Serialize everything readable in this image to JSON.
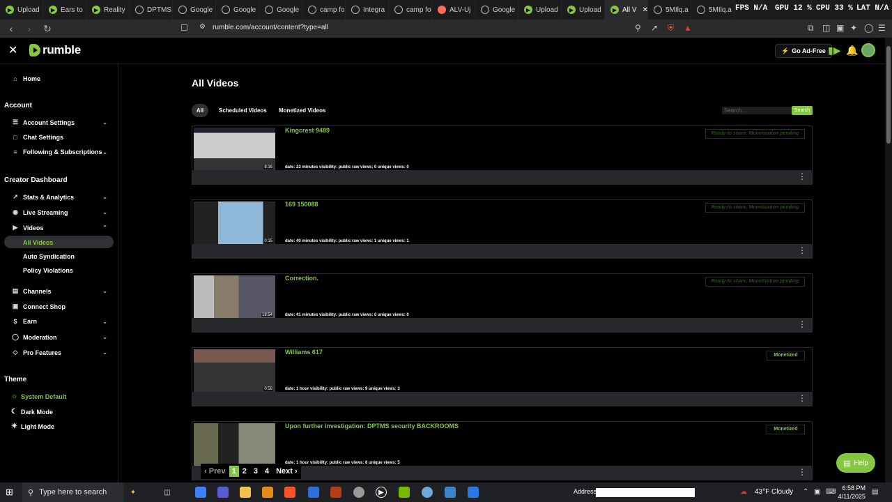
{
  "browser": {
    "tabs": [
      {
        "label": "Upload",
        "icon": "rumble-icon",
        "active": false
      },
      {
        "label": "Ears to",
        "icon": "rumble-icon",
        "active": false
      },
      {
        "label": "Reality",
        "icon": "rumble-icon",
        "active": false
      },
      {
        "label": "DPTMS",
        "icon": "globe-icon",
        "active": false
      },
      {
        "label": "Google",
        "icon": "globe-icon",
        "active": false
      },
      {
        "label": "Google",
        "icon": "globe-icon",
        "active": false
      },
      {
        "label": "Google",
        "icon": "globe-icon",
        "active": false
      },
      {
        "label": "camp fo",
        "icon": "globe-icon",
        "active": false
      },
      {
        "label": "Integra",
        "icon": "globe-icon",
        "active": false
      },
      {
        "label": "camp fo",
        "icon": "globe-icon",
        "active": false
      },
      {
        "label": "ALV-Uj",
        "icon": "brand-icon",
        "active": false
      },
      {
        "label": "Google",
        "icon": "globe-icon",
        "active": false
      },
      {
        "label": "Upload",
        "icon": "rumble-icon",
        "active": false
      },
      {
        "label": "Upload",
        "icon": "rumble-icon",
        "active": false
      },
      {
        "label": "All V",
        "icon": "rumble-icon",
        "active": true
      },
      {
        "label": "5MIlq.a",
        "icon": "globe-icon",
        "active": false
      },
      {
        "label": "5MIlq.a",
        "icon": "globe-icon",
        "active": false
      }
    ],
    "hud": {
      "fps": "FPS N/A",
      "gpu": "GPU 12 %",
      "cpu": "CPU 33 %",
      "lat": "LAT N/A"
    },
    "url": "rumble.com/account/content?type=all"
  },
  "header": {
    "logo": "rumble",
    "go_adfree": "Go Ad-Free"
  },
  "sidebar": {
    "home": "Home",
    "account_heading": "Account",
    "account_items": [
      "Account Settings",
      "Chat Settings",
      "Following & Subscriptions"
    ],
    "creator_heading": "Creator Dashboard",
    "creator_items": [
      "Stats & Analytics",
      "Live Streaming",
      "Videos"
    ],
    "video_subitems": [
      "All Videos",
      "Auto Syndication",
      "Policy Violations"
    ],
    "more_items": [
      "Channels",
      "Connect Shop",
      "Earn",
      "Moderation",
      "Pro Features"
    ],
    "theme_heading": "Theme",
    "theme_items": [
      "System Default",
      "Dark Mode",
      "Light Mode"
    ]
  },
  "main": {
    "title": "All Videos",
    "filters": [
      "All",
      "Scheduled Videos",
      "Monetized Videos"
    ],
    "search_placeholder": "Search...",
    "search_button": "Search",
    "videos": [
      {
        "title": "Kingcrest 9489",
        "duration": "8:16",
        "meta": "date: 23 minutes  visibility: public  raw views: 0  unique views: 0",
        "status": "Ready to share. Monetization pending",
        "monetized": false
      },
      {
        "title": "169 150088",
        "duration": "0:15",
        "meta": "date: 40 minutes  visibility: public  raw views: 1  unique views: 1",
        "status": "Ready to share. Monetization pending",
        "monetized": false
      },
      {
        "title": "Correction.",
        "duration": "18:54",
        "meta": "date: 41 minutes  visibility: public  raw views: 0  unique views: 0",
        "status": "Ready to share. Monetization pending",
        "monetized": false
      },
      {
        "title": "Williams 617",
        "duration": "0:58",
        "meta": "date: 1 hour  visibility: public  raw views: 9  unique views: 3",
        "status": "Monetized",
        "monetized": true
      },
      {
        "title": "Upon further investigation: DPTMS security BACKROOMS",
        "duration": "",
        "meta": "date: 1 hour  visibility: public  raw views: 8  unique views: 5",
        "status": "Monetized",
        "monetized": true
      }
    ],
    "pager": {
      "prev": "Prev",
      "pages": [
        "1",
        "2",
        "3",
        "4"
      ],
      "next": "Next"
    },
    "help": "Help"
  },
  "taskbar": {
    "search": "Type here to search",
    "address_label": "Address",
    "weather": "43°F  Cloudy",
    "time": "6:58 PM",
    "date": "4/11/2025"
  }
}
